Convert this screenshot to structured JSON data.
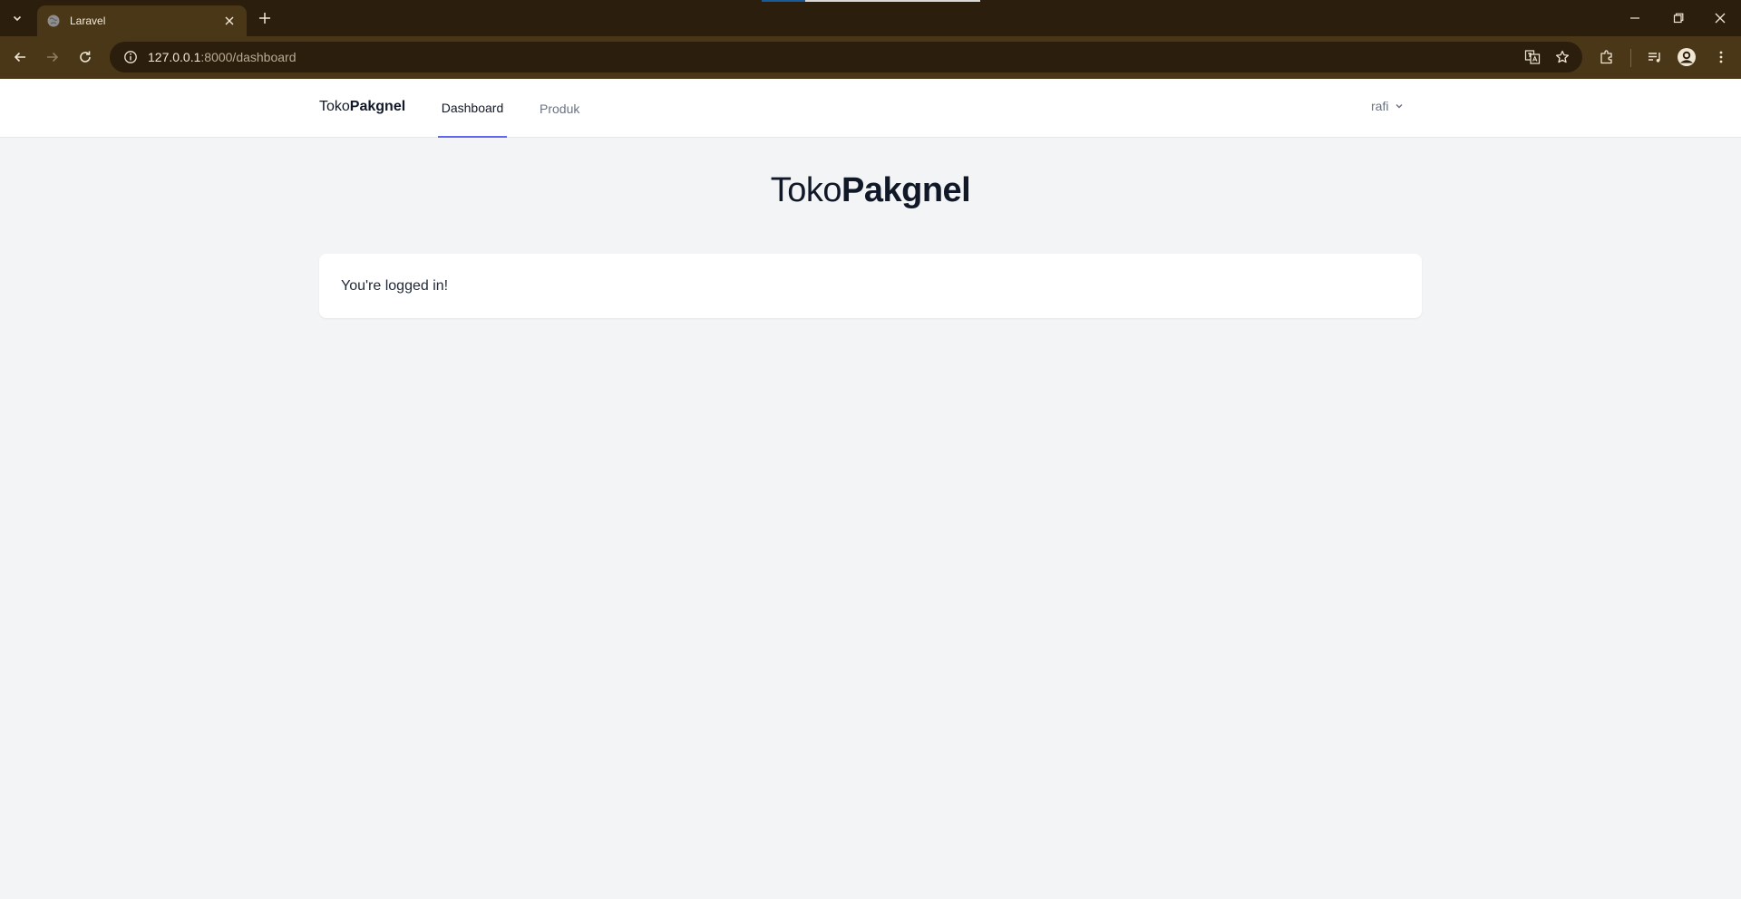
{
  "browser": {
    "tab_title": "Laravel",
    "url_host": "127.0.0.1",
    "url_path": ":8000/dashboard",
    "icons": {
      "tab_search": "chevron-down-icon",
      "favicon": "globe-icon",
      "tab_close": "close-icon",
      "new_tab": "plus-icon",
      "back": "back-arrow-icon",
      "forward": "forward-arrow-icon",
      "reload": "reload-icon",
      "site_info": "info-icon",
      "translate": "translate-icon",
      "bookmark": "star-icon",
      "extensions": "puzzle-icon",
      "media": "media-queue-icon",
      "profile": "profile-avatar-icon",
      "menu": "kebab-menu-icon",
      "minimize": "minimize-icon",
      "restore": "restore-icon",
      "close_window": "close-icon"
    },
    "colors": {
      "tabstrip": "#2c1e0c",
      "toolbar": "#4a3718"
    }
  },
  "navbar": {
    "brand_prefix": "Toko",
    "brand_bold": "Pakgnel",
    "links": [
      {
        "label": "Dashboard",
        "active": true
      },
      {
        "label": "Produk",
        "active": false
      }
    ],
    "user_name": "rafi",
    "accent": "#6366f1"
  },
  "hero": {
    "title_prefix": "Toko",
    "title_bold": "Pakgnel"
  },
  "card": {
    "message": "You're logged in!"
  }
}
